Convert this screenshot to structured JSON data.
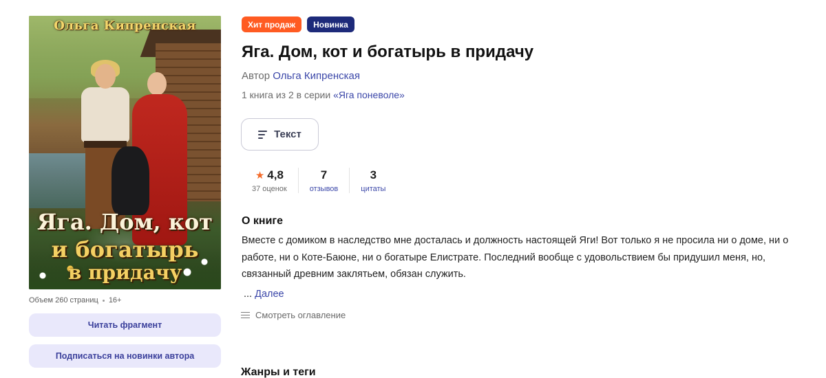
{
  "cover": {
    "author_art": "Ольга Кипренская",
    "title_line1": "Яга. Дом, кот",
    "title_line2": "и богатырь",
    "title_line3": "в придачу"
  },
  "meta": {
    "pages": "Объем 260 страниц",
    "age": "16+"
  },
  "buttons": {
    "read_fragment": "Читать фрагмент",
    "subscribe": "Подписаться на новинки автора"
  },
  "badges": {
    "hit": "Хит продаж",
    "new": "Новинка"
  },
  "book": {
    "title": "Яга. Дом, кот и богатырь в придачу",
    "author_prefix": "Автор",
    "author_name": "Ольга Кипренская",
    "series_prefix": "1 книга из 2 в серии",
    "series_name": "«Яга поневоле»"
  },
  "format": {
    "label": "Текст"
  },
  "stats": {
    "rating": "4,8",
    "rating_label": "37 оценок",
    "reviews": "7",
    "reviews_label": "отзывов",
    "quotes": "3",
    "quotes_label": "цитаты"
  },
  "about": {
    "heading": "О книге",
    "text": "Вместе с домиком в наследство мне досталась и должность настоящей Яги! Вот только я не просила ни о доме, ни о работе, ни о Коте-Баюне, ни о богатыре Елистрате. Последний вообще с удовольствием бы придушил меня, но, связанный древним заклятьем, обязан служить.",
    "more_prefix": "...",
    "more_link": "Далее",
    "toc": "Смотреть оглавление"
  },
  "genres": {
    "heading": "Жанры и теги"
  },
  "colors": {
    "accent_link": "#3a46a8",
    "badge_hit": "#ff5b22",
    "badge_new": "#1d2a7a",
    "star": "#f46a28",
    "soft_button_bg": "#e9e8fb"
  }
}
